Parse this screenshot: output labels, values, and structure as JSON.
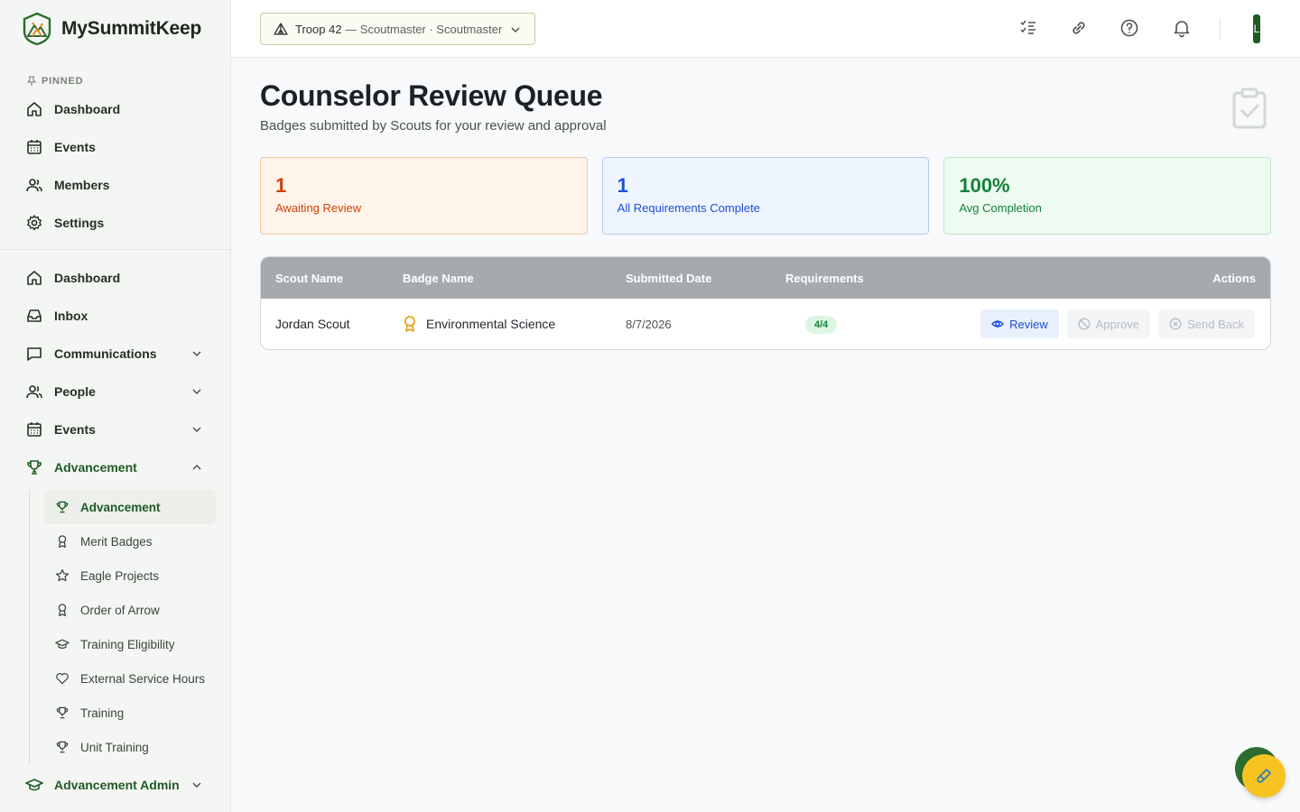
{
  "brand": {
    "name": "MySummitKeep"
  },
  "sidebar": {
    "pinned_label": "PINNED",
    "pinned": [
      {
        "label": "Dashboard",
        "icon": "home-icon"
      },
      {
        "label": "Events",
        "icon": "calendar-icon"
      },
      {
        "label": "Members",
        "icon": "users-icon"
      },
      {
        "label": "Settings",
        "icon": "gear-icon"
      }
    ],
    "main": [
      {
        "label": "Dashboard",
        "icon": "home-icon"
      },
      {
        "label": "Inbox",
        "icon": "inbox-icon"
      },
      {
        "label": "Communications",
        "icon": "message-icon"
      },
      {
        "label": "People",
        "icon": "users-icon"
      },
      {
        "label": "Events",
        "icon": "calendar-icon"
      },
      {
        "label": "Advancement",
        "icon": "trophy-icon"
      }
    ],
    "advancement_sub": [
      {
        "label": "Advancement",
        "icon": "trophy-icon"
      },
      {
        "label": "Merit Badges",
        "icon": "ribbon-icon"
      },
      {
        "label": "Eagle Projects",
        "icon": "star-icon"
      },
      {
        "label": "Order of Arrow",
        "icon": "ribbon-icon"
      },
      {
        "label": "Training Eligibility",
        "icon": "graduation-cap-icon"
      },
      {
        "label": "External Service Hours",
        "icon": "heart-icon"
      },
      {
        "label": "Training",
        "icon": "trophy-icon"
      },
      {
        "label": "Unit Training",
        "icon": "trophy-icon"
      }
    ],
    "advancement_admin": {
      "label": "Advancement Admin",
      "icon": "graduation-cap-icon"
    }
  },
  "header": {
    "troop": "Troop 42",
    "troop_sub": " — Scoutmaster · Scoutmaster",
    "avatar_initial": "L"
  },
  "page": {
    "title": "Counselor Review Queue",
    "subtitle": "Badges submitted by Scouts for your review and approval"
  },
  "stats": [
    {
      "value": "1",
      "label": "Awaiting Review"
    },
    {
      "value": "1",
      "label": "All Requirements Complete"
    },
    {
      "value": "100%",
      "label": "Avg Completion"
    }
  ],
  "table": {
    "columns": [
      "Scout Name",
      "Badge Name",
      "Submitted Date",
      "Requirements",
      "Actions"
    ],
    "rows": [
      {
        "scout": "Jordan Scout",
        "badge": "Environmental Science",
        "date": "8/7/2026",
        "requirements": "4/4"
      }
    ],
    "actions": {
      "review": "Review",
      "approve": "Approve",
      "send_back": "Send Back"
    }
  },
  "colors": {
    "brand_green": "#1f5a24",
    "accent_yellow": "#f7c320"
  }
}
